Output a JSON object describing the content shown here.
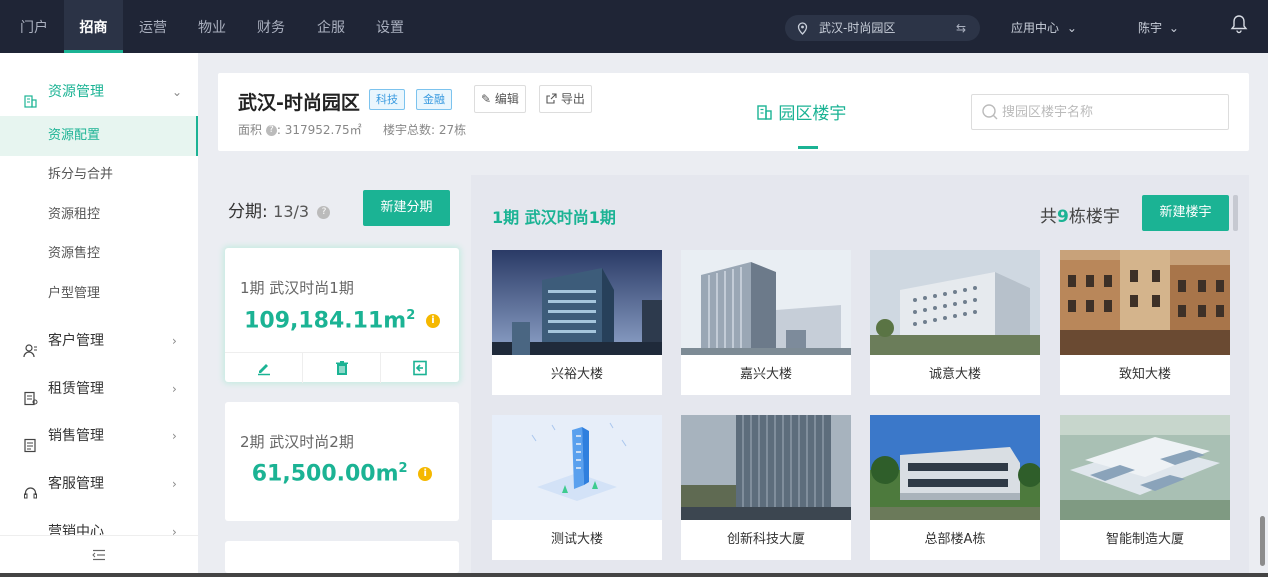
{
  "topbar": {
    "nav": [
      {
        "label": "门户"
      },
      {
        "label": "招商",
        "active": true
      },
      {
        "label": "运营"
      },
      {
        "label": "物业"
      },
      {
        "label": "财务"
      },
      {
        "label": "企服"
      },
      {
        "label": "设置"
      }
    ],
    "park_selector": "武汉-时尚园区",
    "app_center": "应用中心",
    "user": "陈宇"
  },
  "sidebar": {
    "groups": [
      {
        "label": "资源管理",
        "icon": "building-icon",
        "expanded": true,
        "items": [
          "资源配置",
          "拆分与合并",
          "资源租控",
          "资源售控",
          "户型管理"
        ],
        "active_item": "资源配置"
      },
      {
        "label": "客户管理",
        "icon": "user-icon"
      },
      {
        "label": "租赁管理",
        "icon": "lease-icon"
      },
      {
        "label": "销售管理",
        "icon": "sales-icon"
      },
      {
        "label": "客服管理",
        "icon": "headset-icon"
      },
      {
        "label": "营销中心",
        "icon": "chart-icon"
      }
    ],
    "collapse_icon": "collapse-menu-icon"
  },
  "header": {
    "title": "武汉-时尚园区",
    "tags": [
      "科技",
      "金融"
    ],
    "edit_label": "编辑",
    "export_label": "导出",
    "area_label": "面积",
    "area_value": "317952.75㎡",
    "building_count_label": "楼宇总数",
    "building_count_value": "27栋",
    "tab_label": "园区楼宇",
    "search_placeholder": "搜园区楼宇名称"
  },
  "phases": {
    "label": "分期",
    "value": "13/3",
    "new_button": "新建分期",
    "cards": [
      {
        "title": "1期   武汉时尚1期",
        "area": "109,184.11",
        "unit": "m",
        "active": true
      },
      {
        "title": "2期   武汉时尚2期",
        "area": "61,500.00",
        "unit": "m"
      }
    ]
  },
  "buildings": {
    "phase_title": "1期  武汉时尚1期",
    "count_prefix": "共",
    "count": "9",
    "count_suffix": "栋楼宇",
    "new_button": "新建楼宇",
    "items": [
      {
        "name": "兴裕大楼"
      },
      {
        "name": "嘉兴大楼"
      },
      {
        "name": "诚意大楼"
      },
      {
        "name": "致知大楼"
      },
      {
        "name": "测试大楼"
      },
      {
        "name": "创新科技大厦"
      },
      {
        "name": "总部楼A栋"
      },
      {
        "name": "智能制造大厦"
      }
    ]
  },
  "colors": {
    "accent": "#1bb394",
    "topbar": "#1f2536",
    "tag_blue": "#3a9be0",
    "warning": "#f5b800"
  }
}
